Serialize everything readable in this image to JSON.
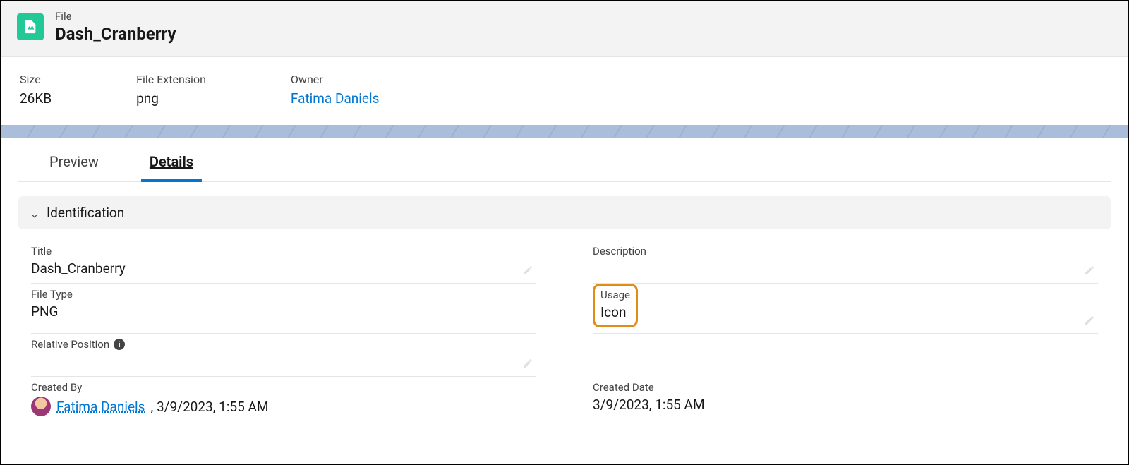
{
  "header": {
    "type_label": "File",
    "file_name": "Dash_Cranberry"
  },
  "summary": {
    "size_label": "Size",
    "size_value": "26KB",
    "ext_label": "File Extension",
    "ext_value": "png",
    "owner_label": "Owner",
    "owner_value": "Fatima Daniels"
  },
  "tabs": {
    "preview": "Preview",
    "details": "Details"
  },
  "section": {
    "identification": "Identification"
  },
  "fields": {
    "title_label": "Title",
    "title_value": "Dash_Cranberry",
    "description_label": "Description",
    "description_value": "",
    "file_type_label": "File Type",
    "file_type_value": "PNG",
    "usage_label": "Usage",
    "usage_value": "Icon",
    "relative_position_label": "Relative Position",
    "relative_position_value": "",
    "created_by_label": "Created By",
    "created_by_user": "Fatima Daniels",
    "created_by_date": ", 3/9/2023, 1:55 AM",
    "created_date_label": "Created Date",
    "created_date_value": "3/9/2023, 1:55 AM"
  }
}
